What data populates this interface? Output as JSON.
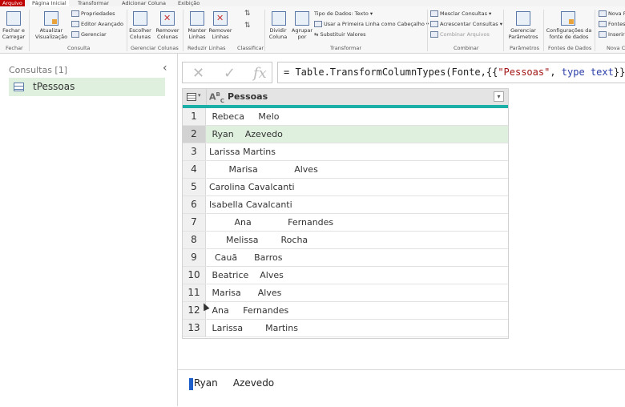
{
  "ribbon_tabs": [
    "Arquivo",
    "Página Inicial",
    "Transformar",
    "Adicionar Coluna",
    "Exibição"
  ],
  "ribbon": {
    "close_load_1": "Fechar e",
    "close_load_2": "Carregar",
    "refresh_1": "Atualizar",
    "refresh_2": "Visualização",
    "properties": "Propriedades",
    "advanced_editor": "Editor Avançado",
    "manage": "Gerenciar",
    "choose_columns_1": "Escolher",
    "choose_columns_2": "Colunas",
    "remove_columns_1": "Remover",
    "remove_columns_2": "Colunas",
    "keep_rows_1": "Manter",
    "keep_rows_2": "Linhas",
    "remove_rows_1": "Remover",
    "remove_rows_2": "Linhas",
    "split_1": "Dividir",
    "split_2": "Coluna",
    "group_1": "Agrupar",
    "group_2": "por",
    "data_type": "Tipo de Dados: Texto",
    "first_row_header": "Usar a Primeira Linha como Cabeçalho",
    "replace_values": "Substituir Valores",
    "merge_queries": "Mesclar Consultas",
    "append_queries": "Acrescentar Consultas",
    "combine_files": "Combinar Arquivos",
    "manage_params_1": "Gerenciar",
    "manage_params_2": "Parâmetros",
    "source_settings_1": "Configurações da",
    "source_settings_2": "fonte de dados",
    "new_1": "Nova F",
    "new_2": "Fontes",
    "new_3": "Inserir",
    "groups": {
      "close": "Fechar",
      "query": "Consulta",
      "manage_cols": "Gerenciar Colunas",
      "reduce_rows": "Reduzir Linhas",
      "sort": "Classificar",
      "transform": "Transformar",
      "combine": "Combinar",
      "params": "Parâmetros",
      "sources": "Fontes de Dados",
      "new": "Nova C"
    }
  },
  "queries_panel": {
    "title": "Consultas [1]",
    "items": [
      {
        "label": "tPessoas"
      }
    ]
  },
  "formula_bar": {
    "prefix": "= Table.TransformColumnTypes(Fonte,{{",
    "string_literal": "\"Pessoas\"",
    "comma": ", ",
    "keyword": "type",
    "type_name": "text",
    "suffix": "}})"
  },
  "table": {
    "type_icon": "ABC",
    "column": "Pessoas",
    "selected_row": 2,
    "rows": [
      {
        "n": "1",
        "value": " Rebeca     Melo"
      },
      {
        "n": "2",
        "value": " Ryan    Azevedo"
      },
      {
        "n": "3",
        "value": "Larissa Martins"
      },
      {
        "n": "4",
        "value": "       Marisa             Alves"
      },
      {
        "n": "5",
        "value": "Carolina Cavalcanti"
      },
      {
        "n": "6",
        "value": "Isabella Cavalcanti"
      },
      {
        "n": "7",
        "value": "         Ana             Fernandes"
      },
      {
        "n": "8",
        "value": "      Melissa        Rocha"
      },
      {
        "n": "9",
        "value": "  Cauã      Barros"
      },
      {
        "n": "10",
        "value": " Beatrice    Alves"
      },
      {
        "n": "11",
        "value": " Marisa      Alves"
      },
      {
        "n": "12",
        "value": " Ana     Fernandes"
      },
      {
        "n": "13",
        "value": " Larissa        Martins"
      }
    ]
  },
  "value_preview": "Ryan     Azevedo",
  "colors": {
    "accent": "#1ab0a8",
    "selection": "#dff0df",
    "file_tab": "#c00000"
  }
}
